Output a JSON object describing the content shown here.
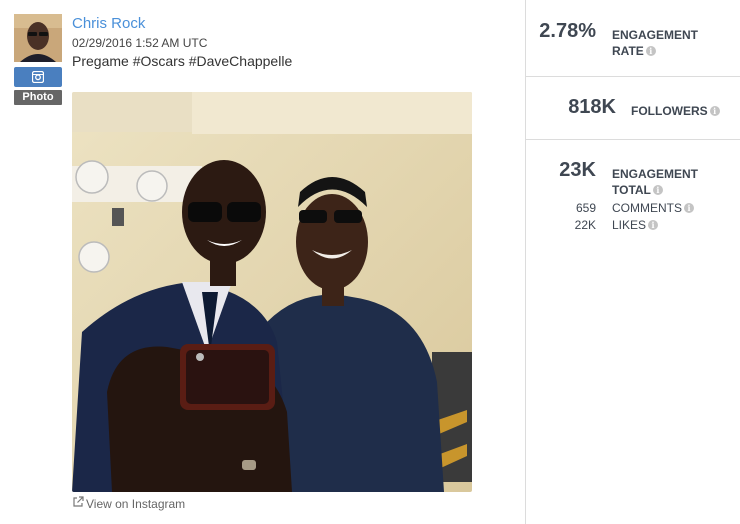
{
  "post": {
    "author": "Chris Rock",
    "timestamp": "02/29/2016 1:52 AM UTC",
    "caption": "Pregame #Oscars #DaveChappelle",
    "network_icon": "instagram-icon",
    "media_type": "Photo",
    "view_link": "View on Instagram"
  },
  "stats": {
    "engagement_rate": {
      "value": "2.78%",
      "label_line1": "ENGAGEMENT",
      "label_line2": "RATE"
    },
    "followers": {
      "value": "818K",
      "label": "FOLLOWERS"
    },
    "engagement_total": {
      "value": "23K",
      "label_line1": "ENGAGEMENT",
      "label_line2": "TOTAL"
    },
    "comments": {
      "value": "659",
      "label": "COMMENTS"
    },
    "likes": {
      "value": "22K",
      "label": "LIKES"
    }
  },
  "colors": {
    "link": "#4a90d9",
    "instagram_badge": "#4a7fbf",
    "stat_text": "#3f4752",
    "divider": "#dcdcdc"
  }
}
